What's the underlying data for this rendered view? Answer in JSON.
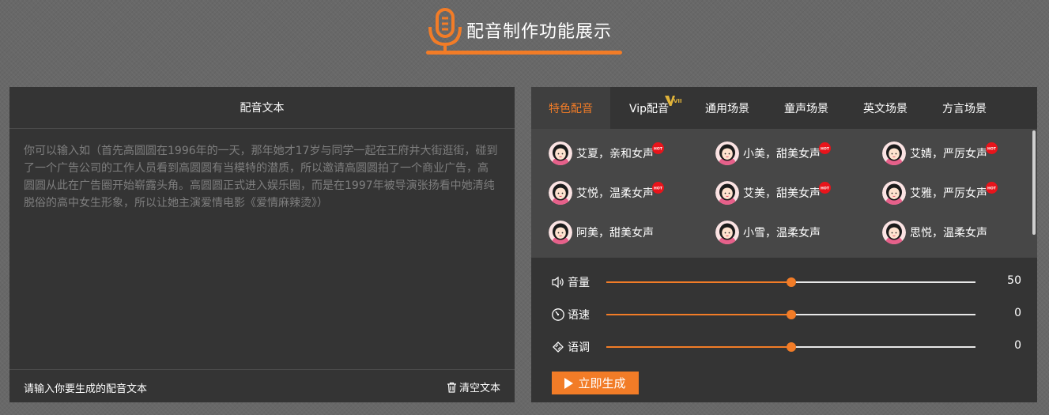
{
  "header": {
    "title": "配音制作功能展示"
  },
  "left": {
    "title": "配音文本",
    "placeholder": "你可以输入如（首先高圆圆在1996年的一天，那年她才17岁与同学一起在王府井大街逛街，碰到了一个广告公司的工作人员看到高圆圆有当模特的潜质，所以邀请高圆圆拍了一个商业广告，高圆圆从此在广告圈开始崭露头角。高圆圆正式进入娱乐圈，而是在1997年被导演张扬看中她清纯脱俗的高中女生形象，所以让她主演爱情电影《爱情麻辣烫》）",
    "footer_label": "请输入你要生成的配音文本",
    "clear_label": "清空文本"
  },
  "tabs": [
    {
      "label": "特色配音",
      "active": true
    },
    {
      "label": "Vip配音",
      "badge": "VIP"
    },
    {
      "label": "通用场景"
    },
    {
      "label": "童声场景"
    },
    {
      "label": "英文场景"
    },
    {
      "label": "方言场景"
    }
  ],
  "voices": [
    {
      "name": "艾夏，亲和女声",
      "hot": true
    },
    {
      "name": "小美，甜美女声",
      "hot": true
    },
    {
      "name": "艾婧，严厉女声",
      "hot": true
    },
    {
      "name": "艾悦，温柔女声",
      "hot": true
    },
    {
      "name": "艾美，甜美女声",
      "hot": true
    },
    {
      "name": "艾雅，严厉女声",
      "hot": true
    },
    {
      "name": "阿美，甜美女声",
      "hot": false
    },
    {
      "name": "小雪，温柔女声",
      "hot": false
    },
    {
      "name": "思悦，温柔女声",
      "hot": false
    }
  ],
  "hot_label": "HOT",
  "sliders": [
    {
      "label": "音量",
      "value": "50",
      "fraction": 0.5,
      "icon": "volume-icon"
    },
    {
      "label": "语速",
      "value": "0",
      "fraction": 0.5,
      "icon": "speed-icon"
    },
    {
      "label": "语调",
      "value": "0",
      "fraction": 0.5,
      "icon": "tone-icon"
    }
  ],
  "generate_label": "立即生成",
  "colors": {
    "accent": "#f27c27",
    "panel": "#343434",
    "voice_bg": "#474747"
  }
}
